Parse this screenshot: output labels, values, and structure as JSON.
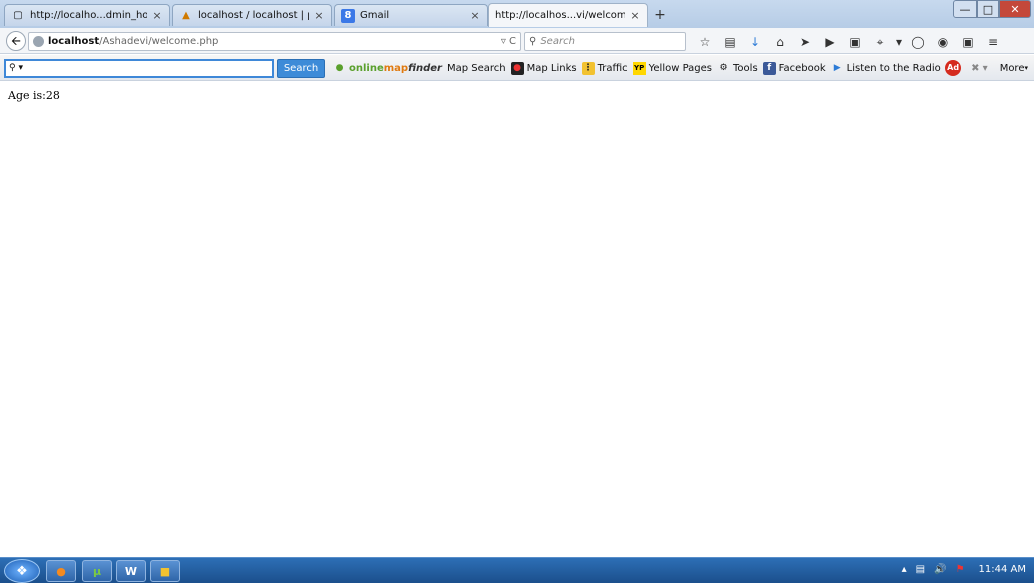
{
  "tabs": [
    {
      "title": "http://localho...dmin_home.php",
      "icon": "blank-page-icon"
    },
    {
      "title": "localhost / localhost | php...",
      "icon": "phpmyadmin-icon"
    },
    {
      "title": "Gmail",
      "icon": "google-icon"
    },
    {
      "title": "http://localhos...vi/welcome.php",
      "icon": "blank-page-icon",
      "active": true
    }
  ],
  "new_tab_label": "+",
  "tab_close_glyph": "×",
  "url": {
    "host": "localhost",
    "path": "/Ashadevi/welcome.php"
  },
  "search_placeholder": "Search",
  "toolbar": {
    "search_button": "Search",
    "links": [
      {
        "label": "Map Search",
        "icon": "onlinemapfinder-logo"
      },
      {
        "label": "Map Links",
        "icon": "map-pin-icon"
      },
      {
        "label": "Traffic",
        "icon": "traffic-light-icon"
      },
      {
        "label": "Yellow Pages",
        "icon": "yp-icon"
      },
      {
        "label": "Tools",
        "icon": "gear-icon"
      },
      {
        "label": "Facebook",
        "icon": "facebook-icon"
      },
      {
        "label": "Listen to the Radio",
        "icon": "play-icon"
      }
    ],
    "logo_text_1": "online",
    "logo_text_2": "map",
    "logo_text_3": "finder",
    "more_label": "More"
  },
  "content": {
    "age_text": "Age is:28"
  },
  "taskbar": {
    "clock": "11:44 AM"
  },
  "colors": {
    "accent": "#3d8bd8",
    "taskbar": "#1b4f8c"
  }
}
